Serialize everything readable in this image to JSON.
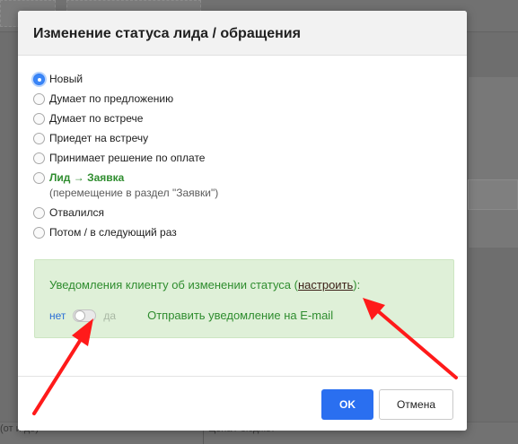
{
  "background": {
    "bottom_left_text": "(от и до)",
    "bottom_mid_text": "Цена / бюджет"
  },
  "dialog": {
    "title": "Изменение статуса лида / обращения",
    "statuses": [
      {
        "label": "Новый",
        "checked": true
      },
      {
        "label": "Думает по предложению",
        "checked": false
      },
      {
        "label": "Думает по встрече",
        "checked": false
      },
      {
        "label": "Приедет на встречу",
        "checked": false
      },
      {
        "label": "Принимает решение по оплате",
        "checked": false
      },
      {
        "label": "Лид → Заявка",
        "sub": "(перемещение в раздел \"Заявки\")",
        "checked": false
      },
      {
        "label": "Отвалился",
        "checked": false
      },
      {
        "label": "Потом / в следующий раз",
        "checked": false
      }
    ],
    "notify": {
      "title_before": "Уведомления клиенту об изменении статуса (",
      "link": "настроить",
      "title_after": "):",
      "toggle_off": "нет",
      "toggle_on": "да",
      "toggle_state": false,
      "toggle_desc": "Отправить уведомление на E-mail"
    },
    "buttons": {
      "ok": "OK",
      "cancel": "Отмена"
    }
  },
  "colors": {
    "ok_button": "#2a6ff0",
    "notify_bg": "#dff0d8",
    "notify_text": "#2f8d2f",
    "arrow": "#ff1a1a"
  }
}
